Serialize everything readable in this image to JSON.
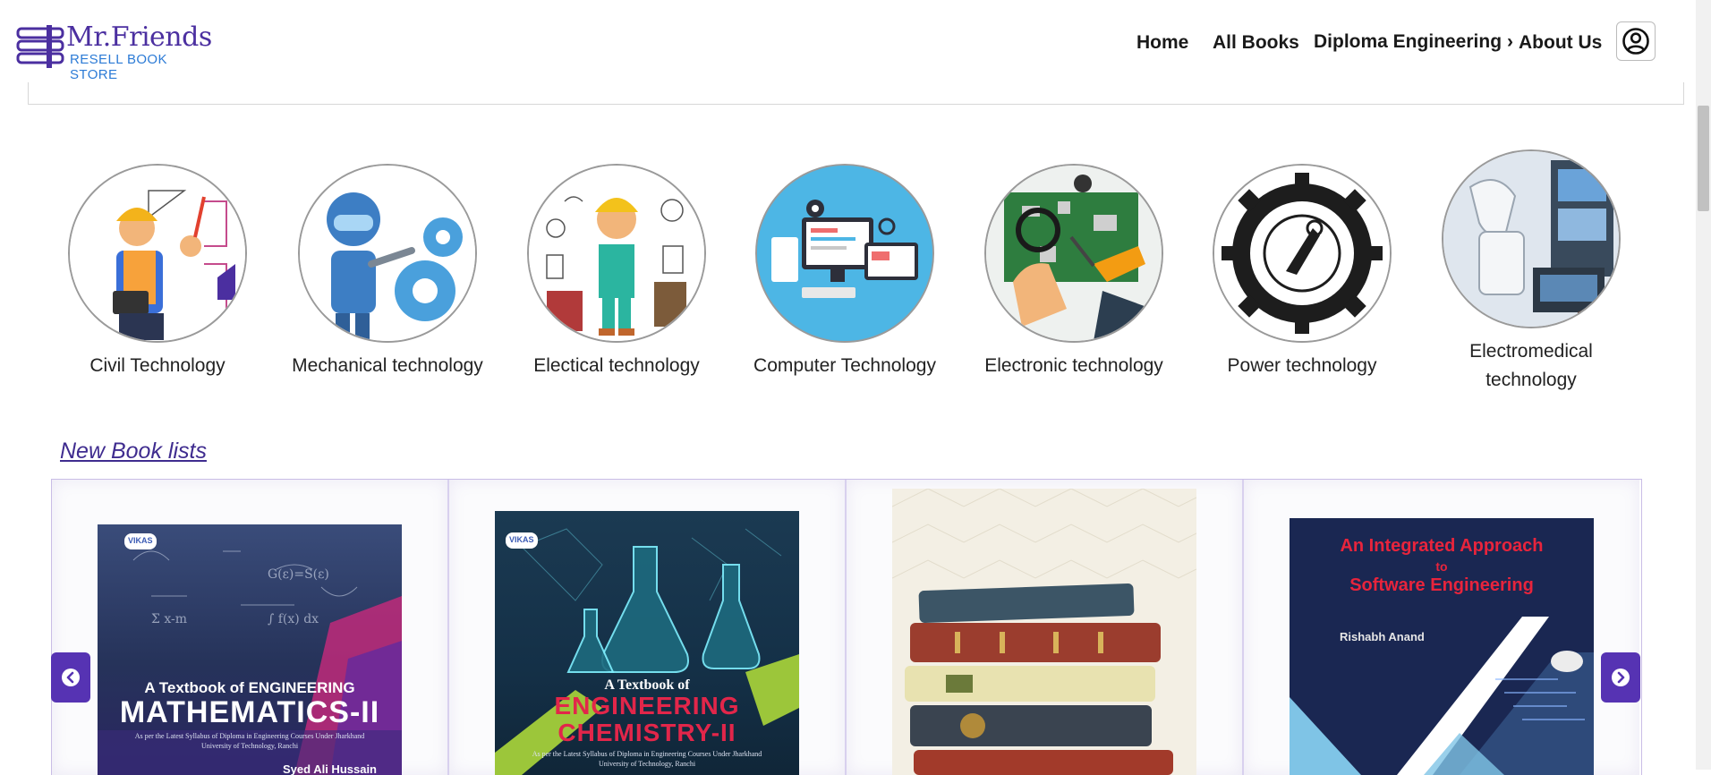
{
  "brand": {
    "name": "Mr.Friends",
    "tagline": "RESELL BOOK STORE",
    "logo_icon": "books-logo-icon"
  },
  "nav": {
    "home": "Home",
    "all_books": "All Books",
    "diploma": "Diploma Engineering",
    "about": "About Us",
    "chevron": "›",
    "profile_icon": "user-circle-icon"
  },
  "categories": [
    {
      "label": "Civil Technology"
    },
    {
      "label": "Mechanical technology"
    },
    {
      "label": "Electical technology"
    },
    {
      "label": "Computer Technology"
    },
    {
      "label": "Electronic technology"
    },
    {
      "label": "Power technology"
    },
    {
      "label": "Electromedical technology"
    }
  ],
  "new_books": {
    "title": "New Book lists",
    "books": [
      {
        "publisher": "VIKAS",
        "line1": "A Textbook of ENGINEERING",
        "line2": "MATHEMATICS-II",
        "note": "As per the Latest Syllabus of Diploma in Engineering Courses Under Jharkhand University of Technology, Ranchi",
        "author": "Syed Ali Hussain"
      },
      {
        "publisher": "VIKAS",
        "line1": "A Textbook of",
        "line2": "ENGINEERING",
        "line3": "CHEMISTRY-II",
        "note": "As per the Latest Syllabus of Diploma in Engineering Courses Under Jharkhand University of Technology, Ranchi"
      },
      {
        "image": "stack-of-old-books"
      },
      {
        "line1": "An Integrated Approach",
        "line2": "to",
        "line3": "Software Engineering",
        "author": "Rishabh Anand"
      }
    ]
  },
  "carousel": {
    "prev_icon": "chevron-left-icon",
    "next_icon": "chevron-right-icon"
  },
  "colors": {
    "brand_purple": "#4b2fa0",
    "accent_blue": "#2c7bd6",
    "carousel_btn": "#5633b3"
  }
}
